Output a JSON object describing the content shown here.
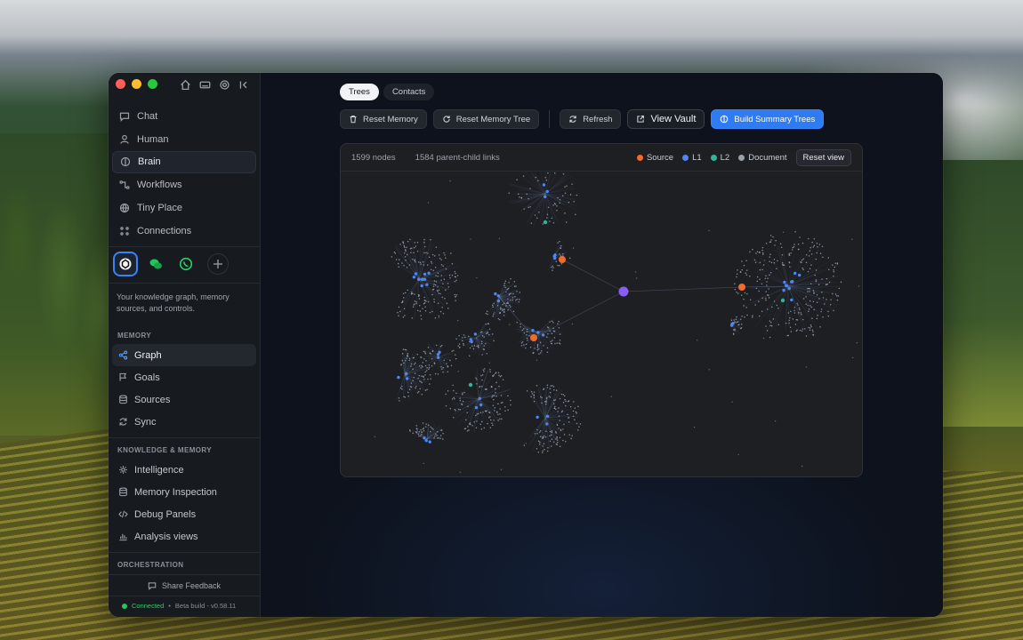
{
  "colors": {
    "source": "#f26b2a",
    "l1": "#4f86f7",
    "l2": "#2fb59a",
    "document": "#9aa0a8",
    "primary": "#2f7bf2",
    "hub": "#8b5cf6"
  },
  "sidebar": {
    "nav": [
      {
        "label": "Chat",
        "icon": "chat-icon"
      },
      {
        "label": "Human",
        "icon": "person-icon"
      },
      {
        "label": "Brain",
        "icon": "brain-icon",
        "active": true
      },
      {
        "label": "Workflows",
        "icon": "workflow-icon"
      },
      {
        "label": "Tiny Place",
        "icon": "globe-icon"
      },
      {
        "label": "Connections",
        "icon": "connections-icon"
      }
    ],
    "channels": [
      "openai-icon",
      "wechat-icon",
      "whatsapp-icon",
      "plus-icon"
    ],
    "description": "Your knowledge graph, memory sources, and controls.",
    "memory_label": "MEMORY",
    "memory_items": [
      {
        "label": "Graph",
        "icon": "graph-icon",
        "active": true
      },
      {
        "label": "Goals",
        "icon": "flag-icon"
      },
      {
        "label": "Sources",
        "icon": "database-icon"
      },
      {
        "label": "Sync",
        "icon": "sync-icon"
      }
    ],
    "knowledge_label": "KNOWLEDGE & MEMORY",
    "knowledge_items": [
      {
        "label": "Intelligence",
        "icon": "sparkle-icon"
      },
      {
        "label": "Memory Inspection",
        "icon": "database-icon"
      },
      {
        "label": "Debug Panels",
        "icon": "code-icon"
      },
      {
        "label": "Analysis views",
        "icon": "bar-chart-icon"
      }
    ],
    "orchestration_label": "ORCHESTRATION",
    "feedback": "Share Feedback",
    "status": "Connected",
    "build": "Beta build - v0.58.11"
  },
  "main": {
    "tabs": [
      {
        "label": "Trees",
        "active": true
      },
      {
        "label": "Contacts",
        "active": false
      }
    ],
    "toolbar": {
      "reset_memory": "Reset Memory",
      "reset_memory_tree": "Reset Memory Tree",
      "refresh": "Refresh",
      "view_vault": "View Vault",
      "build_summary": "Build Summary Trees"
    },
    "graph": {
      "nodes_count": "1599 nodes",
      "links_count": "1584 parent-child links",
      "legend": [
        {
          "label": "Source",
          "color": "#f26b2a"
        },
        {
          "label": "L1",
          "color": "#4f86f7"
        },
        {
          "label": "L2",
          "color": "#2fb59a"
        },
        {
          "label": "Document",
          "color": "#9aa0a8"
        }
      ],
      "reset_view": "Reset view"
    }
  }
}
